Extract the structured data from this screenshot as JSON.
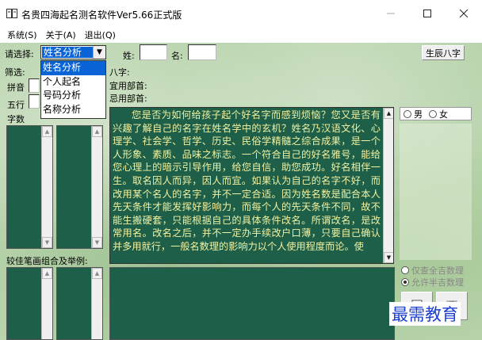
{
  "window": {
    "title": "名贵四海起名测名软件Ver5.66正式版",
    "min_icon": "minimize-icon",
    "max_icon": "maximize-icon",
    "close_icon": "close-icon"
  },
  "menu": [
    "系统(S)",
    "关于(A)",
    "退出(Q)"
  ],
  "form": {
    "select_label": "请选择:",
    "selected_mode": "姓名分析",
    "mode_options": [
      "姓名分析",
      "个人起名",
      "号码分析",
      "名称分析"
    ],
    "surname_label": "姓:",
    "surname_value": "",
    "given_label": "名:",
    "given_value": "",
    "birth_button": "生辰八字",
    "bazi_label": "八字:",
    "suitable_label": "宜用部首:",
    "avoid_label": "忌用部首:",
    "filter_label": "筛选:",
    "pinyin_label": "拼音",
    "wuxing_label": "五行",
    "strokes_label": "字数",
    "combo_label": "较佳笔画组合及举例:"
  },
  "gender": {
    "male": "男",
    "female": "女",
    "selected": "none"
  },
  "options": {
    "show_all": "仅查全吉数理",
    "allow_half": "允许半吉数理",
    "selected": "allow_half"
  },
  "description": "您是否为如何给孩子起个好名字而感到烦恼？您又是否有兴趣了解自己的名字在姓名学中的玄机？姓名乃汉语文化、心理学、社会学、哲学、历史、民俗学精髓之综合成果，是一个人形象、素质、品味之标志。一个符合自己的好名雅号，能给您心理上的暗示引导作用，给您自信，助您成功。好名相伴一生。取名因人而异，因人而宜。如果认为自己的名字不好，而改用某个名人的名字，并不一定合适。因为姓名数是配合本人先天条件才能发挥好影响力，而每个人的先天条件不同，故不能生搬硬套，只能根据自己的具体条件改名。所谓改名，是改常用名。改名之后，并不一定办手续改户口薄，只要自己确认并多用就行，一般名数理的影响力以个人使用程度而论。使",
  "watermark": "最需教育",
  "colors": {
    "list_bg": "#1e5f49",
    "text_fg": "#f2f2a0",
    "selection": "#0a64d6",
    "bg": "#b9d4ad"
  }
}
